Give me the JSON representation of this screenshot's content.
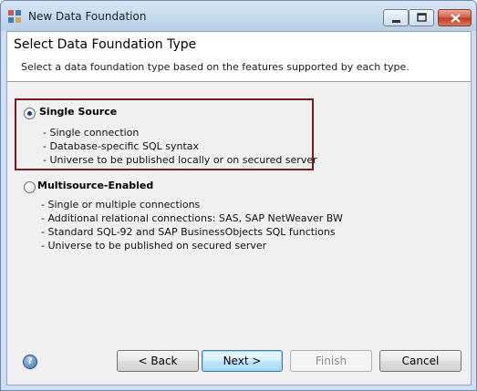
{
  "window": {
    "title": "New Data Foundation"
  },
  "header": {
    "title": "Select Data Foundation Type",
    "subtitle": "Select a data foundation type based on the features supported by each type."
  },
  "options": [
    {
      "label": "Single Source",
      "selected": true,
      "features": [
        "- Single connection",
        "- Database-specific SQL syntax",
        "- Universe to be published locally or on secured server"
      ]
    },
    {
      "label": "Multisource-Enabled",
      "selected": false,
      "features": [
        "- Single or multiple connections",
        "- Additional relational connections: SAS, SAP NetWeaver BW",
        "- Standard SQL-92 and SAP BusinessObjects SQL functions",
        "- Universe to be published on secured server"
      ]
    }
  ],
  "buttons": {
    "back": "< Back",
    "next": "Next >",
    "finish": "Finish",
    "cancel": "Cancel",
    "finish_enabled": false
  },
  "icons": {
    "app": "data-foundation-app-icon",
    "help": "help-icon"
  },
  "colors": {
    "selection_border": "#7b1a21",
    "titlebar": "#c7daef"
  }
}
